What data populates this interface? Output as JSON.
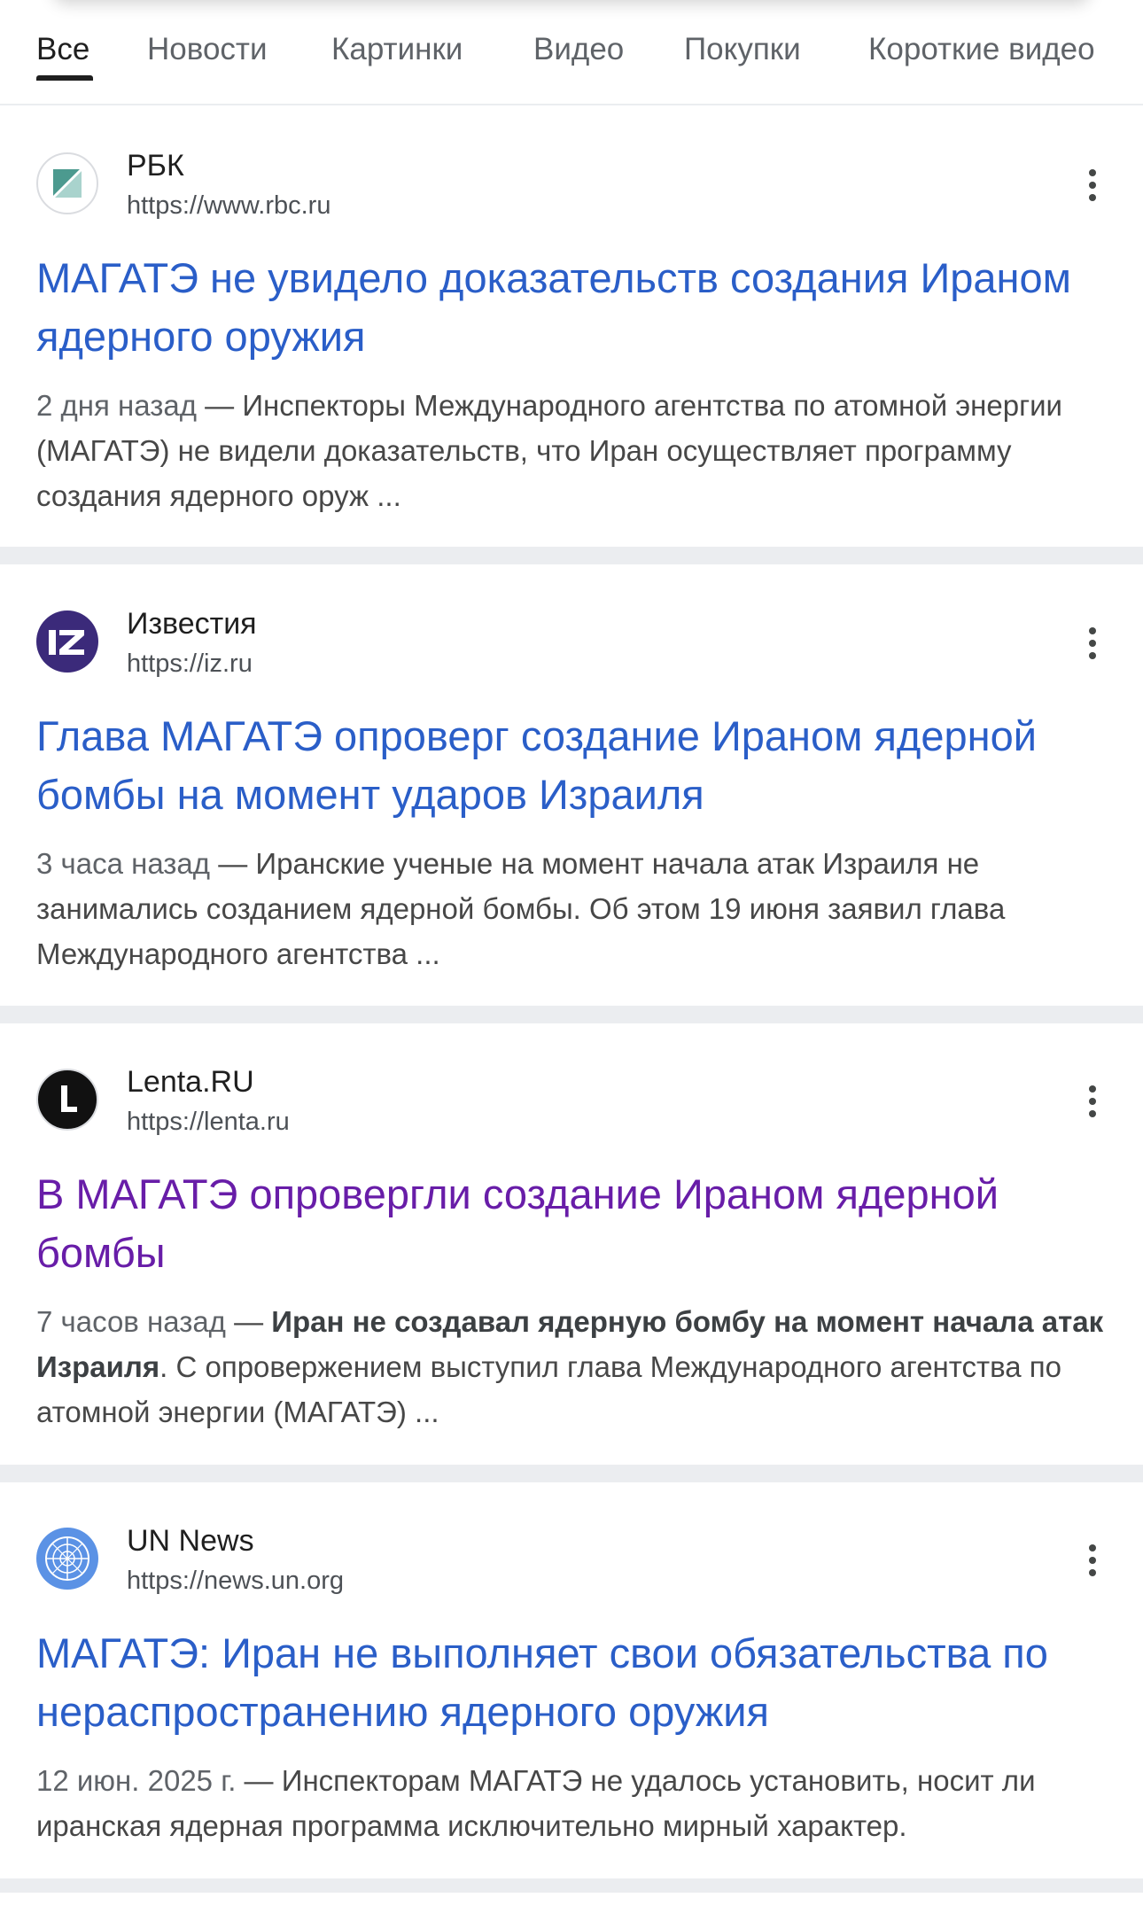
{
  "tabs": [
    {
      "label": "Все",
      "active": true
    },
    {
      "label": "Новости",
      "active": false
    },
    {
      "label": "Картинки",
      "active": false
    },
    {
      "label": "Видео",
      "active": false
    },
    {
      "label": "Покупки",
      "active": false
    },
    {
      "label": "Короткие видео",
      "active": false
    }
  ],
  "colors": {
    "link": "#2a5ec8",
    "visited_link": "#681da8",
    "separator": "#ebedf0"
  },
  "results": [
    {
      "favicon": "rbc-icon",
      "site_name": "РБК",
      "url": "https://www.rbc.ru",
      "title": "МАГАТЭ не увидело доказательств создания Ираном ядерного оружия",
      "visited": false,
      "date": "2 дня назад",
      "dash": " — ",
      "snippet_bold": "",
      "snippet": "Инспекторы Международного агентства по атомной энергии (МАГАТЭ) не видели доказательств, что Иран осуществляет программу создания ядерного оруж ..."
    },
    {
      "favicon": "izvestia-icon",
      "site_name": "Известия",
      "url": "https://iz.ru",
      "title": "Глава МАГАТЭ опроверг создание Ираном ядерной бомбы на момент ударов Израиля",
      "visited": false,
      "date": "3 часа назад",
      "dash": " — ",
      "snippet_bold": "",
      "snippet": "Иранские ученые на момент начала атак Израиля не занимались созданием ядерной бомбы. Об этом 19 июня заявил глава Международного агентства ..."
    },
    {
      "favicon": "lenta-icon",
      "site_name": "Lenta.RU",
      "url": "https://lenta.ru",
      "title": "В МАГАТЭ опровергли создание Ираном ядерной бомбы",
      "visited": true,
      "date": "7 часов назад",
      "dash": " — ",
      "snippet_bold": "Иран не создавал ядерную бомбу на момент начала атак Израиля",
      "snippet": ". С опровержением выступил глава Международного агентства по атомной энергии (МАГАТЭ) ..."
    },
    {
      "favicon": "un-icon",
      "site_name": "UN News",
      "url": "https://news.un.org",
      "title": "МАГАТЭ: Иран не выполняет свои обязательства по нераспространению ядерного оружия",
      "visited": false,
      "date": "12 июн. 2025 г.",
      "dash": " — ",
      "snippet_bold": "",
      "snippet": "Инспекторам МАГАТЭ не удалось установить, носит ли иранская ядерная программа исключительно мирный характер."
    }
  ]
}
